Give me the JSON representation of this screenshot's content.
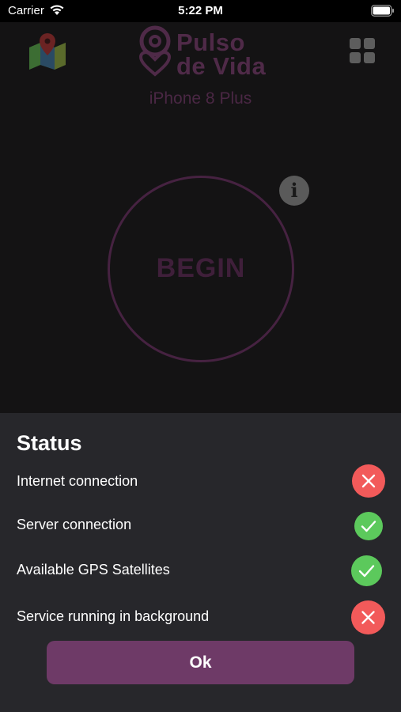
{
  "status_bar": {
    "carrier": "Carrier",
    "time": "5:22 PM"
  },
  "app": {
    "logo_line1": "Pulso",
    "logo_line2": "de Vida",
    "device_name": "iPhone 8 Plus",
    "begin_label": "BEGIN",
    "info_glyph": "i",
    "icons": [
      "map-pin-icon",
      "grid-menu-icon",
      "info-icon"
    ]
  },
  "status_sheet": {
    "title": "Status",
    "items": [
      {
        "label": "Internet connection",
        "state": "fail",
        "icon": "x-icon"
      },
      {
        "label": "Server connection",
        "state": "ok",
        "icon": "check-icon"
      },
      {
        "label": "Available GPS Satellites",
        "state": "ok",
        "icon": "check-icon"
      },
      {
        "label": "Service running in background",
        "state": "fail",
        "icon": "x-icon"
      }
    ],
    "ok_label": "Ok"
  },
  "colors": {
    "accent": "#6e3a67",
    "fail": "#f25a5a",
    "ok": "#5cc95c",
    "sheet_bg": "#27272b"
  }
}
